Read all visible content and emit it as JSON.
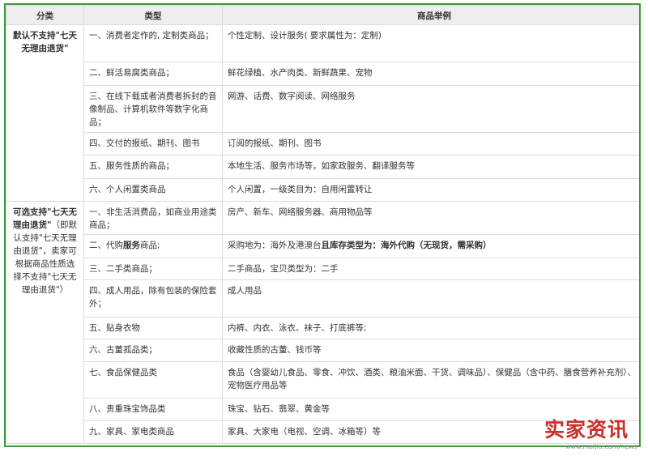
{
  "table": {
    "headers": [
      "分类",
      "类型",
      "商品举例"
    ],
    "groups": [
      {
        "category_bold": "默认不支持\"七天无理由退货\"",
        "category_rest": "",
        "rows": [
          {
            "type": "一、消费者定作的, 定制类商品；",
            "example": "个性定制、设计服务( 要求属性为：定制)"
          },
          {
            "type": "二、鲜活易腐类商品；",
            "example": "鲜花绿植、水产肉类、新鲜蔬果、宠物"
          },
          {
            "type": "三、在线下载或者消费者拆封的音像制品、计算机软件等数字化商品；",
            "example": "网游、话费、数字阅读、网络服务"
          },
          {
            "type": "四、交付的报纸、期刊、图书",
            "example": "订阅的报纸、期刊、图书"
          },
          {
            "type": "五、服务性质的商品；",
            "example": "本地生活、服务市场等，如家政服务、翻译服务等"
          },
          {
            "type": "六、个人闲置类商品",
            "example": "个人闲置，一级类目为：自用闲置转让"
          }
        ]
      },
      {
        "category_bold": "可选支持\"七天无理由退货\"",
        "category_rest": "（即默认支持\"七天无理由退货\"，卖家可根据商品性质选择不支持\"七天无理由退货\"）",
        "rows": [
          {
            "type": "一、非生活消费品，如商业用途类商品；",
            "example": "房产、新车、网络服务器、商用物品等"
          },
          {
            "type_plain": "二、代购",
            "type_bold": "服务",
            "type_tail": "商品;",
            "example_plain": "采购地为：海外及港澳台",
            "example_bold": "且库存类型为：海外代购（无现货，需采购）"
          },
          {
            "type": "三、二手类商品；",
            "example": "二手商品，宝贝类型为：二手"
          },
          {
            "type": "四、成人用品，除有包装的保险套外；",
            "example": "成人用品"
          },
          {
            "type": "五、贴身衣物",
            "example": "内裤、内衣、泳衣、袜子、打底裤等;"
          },
          {
            "type": "六、古董孤品类；",
            "example": "收藏性质的古董、钱币等"
          },
          {
            "type": "七、食品保健品类",
            "example": "食品（含婴幼儿食品、零食、冲饮、酒类、粮油米面、干货、调味品）、保健品（含中药、膳食营养补充剂）、宠物医疗用品等"
          },
          {
            "type": "八、贵重珠宝饰品类",
            "example": "珠宝、钻石、翡翠、黄金等"
          },
          {
            "type": "九、家具、家电类商品",
            "example": "家具、大家电（电视、空调、冰箱等）等"
          }
        ]
      }
    ]
  },
  "watermark": {
    "title": "实家资讯",
    "url": "www.maijia.com/news"
  },
  "colors": {
    "frame_border": "#3c9a3c",
    "header_bg": "#eeeeee",
    "grid": "#dcdcdc",
    "watermark_red": "#c9302c"
  }
}
